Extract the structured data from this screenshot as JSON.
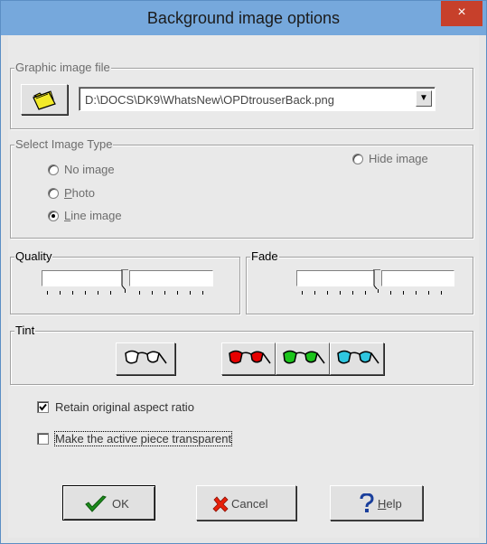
{
  "window": {
    "title": "Background image options",
    "close": "×"
  },
  "graphic_file": {
    "legend": "Graphic image file",
    "path": "D:\\DOCS\\DK9\\WhatsNew\\OPDtrouserBack.png",
    "dropdown_arrow": "▼"
  },
  "image_type": {
    "legend": "Select Image Type",
    "hide_label": "Hide image",
    "options": [
      {
        "label": "No image",
        "u": "",
        "rest": "No image",
        "selected": false
      },
      {
        "label": "Photo",
        "u": "P",
        "rest": "hoto",
        "selected": false
      },
      {
        "label": "Line image",
        "u": "L",
        "rest": "ine image",
        "selected": true
      }
    ]
  },
  "quality": {
    "legend": "Quality",
    "level": 0.5
  },
  "fade": {
    "legend": "Fade",
    "level": 0.5
  },
  "tint": {
    "legend": "Tint",
    "colors": [
      "none",
      "#e60000",
      "#1cc41c",
      "#2fc6e0"
    ]
  },
  "options": {
    "retain_label": "Retain original aspect ratio",
    "retain_checked": true,
    "transparent_label": "Make the active piece transparent",
    "transparent_checked": false
  },
  "buttons": {
    "ok": "OK",
    "cancel": "Cancel",
    "help_u": "H",
    "help_rest": "elp"
  }
}
